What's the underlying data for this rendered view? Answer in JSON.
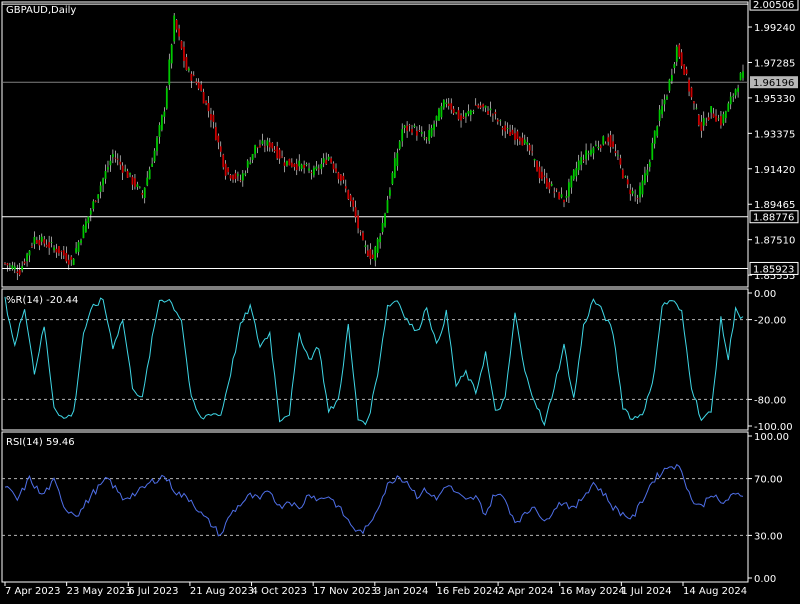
{
  "app": {
    "symbol_title": "GBPAUD,Daily",
    "wr_label": "%R(14) -20.44",
    "rsi_label": "RSI(14) 59.46"
  },
  "colors": {
    "background": "#000000",
    "frame": "#ffffff",
    "bull": "#00c800",
    "bear": "#c80000",
    "wick": "#ffffff",
    "wr_line": "#3fd7e6",
    "rsi_line": "#4f6fe8",
    "level_line": "#b4b4b4",
    "price_line": "#808080",
    "price_tag_bg": "#b7b7b7"
  },
  "chart_data": [
    {
      "type": "candlestick",
      "title": "GBPAUD,Daily",
      "y_ticks": [
        "1.99240",
        "1.97285",
        "1.95330",
        "1.93375",
        "1.91420",
        "1.89465",
        "1.87510",
        "1.85555"
      ],
      "ylim": [
        1.849,
        2.0062
      ],
      "highlighted_prices": [
        "2.00506",
        "1.88776",
        "1.85923"
      ],
      "current_price": "1.96196",
      "x_ticks": [
        "7 Apr 2023",
        "23 May 2023",
        "6 Jul 2023",
        "21 Aug 2023",
        "4 Oct 2023",
        "17 Nov 2023",
        "3 Jan 2024",
        "16 Feb 2024",
        "2 Apr 2024",
        "16 May 2024",
        "1 Jul 2024",
        "14 Aug 2024"
      ],
      "close_keypoints": [
        [
          0,
          1.862
        ],
        [
          6,
          1.858
        ],
        [
          12,
          1.876
        ],
        [
          18,
          1.872
        ],
        [
          22,
          1.869
        ],
        [
          27,
          1.863
        ],
        [
          32,
          1.881
        ],
        [
          38,
          1.902
        ],
        [
          44,
          1.922
        ],
        [
          50,
          1.911
        ],
        [
          56,
          1.9
        ],
        [
          61,
          1.924
        ],
        [
          65,
          1.948
        ],
        [
          69,
          1.996
        ],
        [
          74,
          1.969
        ],
        [
          79,
          1.96
        ],
        [
          84,
          1.943
        ],
        [
          90,
          1.913
        ],
        [
          96,
          1.908
        ],
        [
          102,
          1.926
        ],
        [
          108,
          1.928
        ],
        [
          114,
          1.918
        ],
        [
          120,
          1.916
        ],
        [
          126,
          1.912
        ],
        [
          132,
          1.921
        ],
        [
          138,
          1.906
        ],
        [
          142,
          1.892
        ],
        [
          146,
          1.872
        ],
        [
          150,
          1.865
        ],
        [
          154,
          1.884
        ],
        [
          158,
          1.911
        ],
        [
          162,
          1.936
        ],
        [
          166,
          1.937
        ],
        [
          172,
          1.93
        ],
        [
          176,
          1.942
        ],
        [
          180,
          1.952
        ],
        [
          186,
          1.941
        ],
        [
          192,
          1.949
        ],
        [
          198,
          1.946
        ],
        [
          204,
          1.935
        ],
        [
          210,
          1.932
        ],
        [
          214,
          1.924
        ],
        [
          218,
          1.911
        ],
        [
          224,
          1.902
        ],
        [
          228,
          1.897
        ],
        [
          234,
          1.918
        ],
        [
          240,
          1.926
        ],
        [
          246,
          1.931
        ],
        [
          250,
          1.919
        ],
        [
          254,
          1.904
        ],
        [
          258,
          1.898
        ],
        [
          262,
          1.914
        ],
        [
          266,
          1.94
        ],
        [
          270,
          1.956
        ],
        [
          274,
          1.981
        ],
        [
          277,
          1.969
        ],
        [
          280,
          1.953
        ],
        [
          284,
          1.937
        ],
        [
          288,
          1.946
        ],
        [
          292,
          1.94
        ],
        [
          296,
          1.952
        ],
        [
          300,
          1.965
        ]
      ]
    },
    {
      "type": "line",
      "title": "%R(14) -20.44",
      "y_ticks": [
        "0.00",
        "-20.00",
        "-80.00",
        "-100.00"
      ],
      "ylim": [
        -100,
        0
      ],
      "levels": [
        -20,
        -80
      ],
      "keypoints": [
        [
          0,
          -5
        ],
        [
          4,
          -40
        ],
        [
          8,
          -10
        ],
        [
          12,
          -60
        ],
        [
          16,
          -25
        ],
        [
          20,
          -85
        ],
        [
          24,
          -95
        ],
        [
          28,
          -90
        ],
        [
          32,
          -30
        ],
        [
          36,
          -10
        ],
        [
          40,
          -5
        ],
        [
          44,
          -40
        ],
        [
          48,
          -20
        ],
        [
          52,
          -70
        ],
        [
          56,
          -80
        ],
        [
          60,
          -35
        ],
        [
          63,
          -5
        ],
        [
          67,
          -5
        ],
        [
          72,
          -20
        ],
        [
          76,
          -80
        ],
        [
          80,
          -95
        ],
        [
          84,
          -90
        ],
        [
          88,
          -92
        ],
        [
          92,
          -60
        ],
        [
          96,
          -25
        ],
        [
          100,
          -10
        ],
        [
          104,
          -40
        ],
        [
          108,
          -30
        ],
        [
          112,
          -95
        ],
        [
          116,
          -90
        ],
        [
          120,
          -30
        ],
        [
          124,
          -50
        ],
        [
          128,
          -40
        ],
        [
          132,
          -90
        ],
        [
          136,
          -80
        ],
        [
          140,
          -25
        ],
        [
          144,
          -95
        ],
        [
          148,
          -97
        ],
        [
          152,
          -60
        ],
        [
          156,
          -10
        ],
        [
          160,
          -5
        ],
        [
          164,
          -20
        ],
        [
          168,
          -30
        ],
        [
          172,
          -10
        ],
        [
          176,
          -40
        ],
        [
          180,
          -15
        ],
        [
          184,
          -70
        ],
        [
          188,
          -60
        ],
        [
          192,
          -75
        ],
        [
          196,
          -45
        ],
        [
          200,
          -90
        ],
        [
          204,
          -80
        ],
        [
          208,
          -15
        ],
        [
          212,
          -60
        ],
        [
          216,
          -80
        ],
        [
          220,
          -100
        ],
        [
          224,
          -70
        ],
        [
          228,
          -40
        ],
        [
          232,
          -80
        ],
        [
          236,
          -25
        ],
        [
          240,
          -5
        ],
        [
          244,
          -15
        ],
        [
          248,
          -30
        ],
        [
          252,
          -85
        ],
        [
          256,
          -95
        ],
        [
          260,
          -90
        ],
        [
          264,
          -70
        ],
        [
          268,
          -10
        ],
        [
          272,
          -5
        ],
        [
          276,
          -15
        ],
        [
          280,
          -70
        ],
        [
          284,
          -95
        ],
        [
          288,
          -90
        ],
        [
          292,
          -20
        ],
        [
          295,
          -50
        ],
        [
          298,
          -10
        ],
        [
          300,
          -20
        ]
      ]
    },
    {
      "type": "line",
      "title": "RSI(14) 59.46",
      "y_ticks": [
        "100.00",
        "70.00",
        "30.00",
        "0.00"
      ],
      "ylim": [
        0,
        100
      ],
      "levels": [
        70,
        30
      ],
      "keypoints": [
        [
          0,
          65
        ],
        [
          5,
          55
        ],
        [
          10,
          70
        ],
        [
          15,
          58
        ],
        [
          20,
          68
        ],
        [
          25,
          48
        ],
        [
          30,
          45
        ],
        [
          36,
          60
        ],
        [
          42,
          70
        ],
        [
          48,
          56
        ],
        [
          54,
          60
        ],
        [
          60,
          68
        ],
        [
          65,
          72
        ],
        [
          70,
          60
        ],
        [
          76,
          55
        ],
        [
          80,
          45
        ],
        [
          84,
          38
        ],
        [
          88,
          30
        ],
        [
          92,
          45
        ],
        [
          96,
          52
        ],
        [
          100,
          58
        ],
        [
          104,
          55
        ],
        [
          108,
          62
        ],
        [
          112,
          50
        ],
        [
          116,
          55
        ],
        [
          120,
          48
        ],
        [
          124,
          60
        ],
        [
          128,
          55
        ],
        [
          132,
          58
        ],
        [
          136,
          50
        ],
        [
          140,
          40
        ],
        [
          144,
          32
        ],
        [
          148,
          35
        ],
        [
          152,
          50
        ],
        [
          156,
          65
        ],
        [
          160,
          72
        ],
        [
          164,
          68
        ],
        [
          168,
          58
        ],
        [
          172,
          62
        ],
        [
          176,
          55
        ],
        [
          180,
          66
        ],
        [
          184,
          60
        ],
        [
          188,
          54
        ],
        [
          192,
          57
        ],
        [
          196,
          45
        ],
        [
          200,
          60
        ],
        [
          204,
          55
        ],
        [
          208,
          40
        ],
        [
          212,
          44
        ],
        [
          216,
          52
        ],
        [
          220,
          38
        ],
        [
          224,
          50
        ],
        [
          228,
          54
        ],
        [
          232,
          48
        ],
        [
          236,
          58
        ],
        [
          240,
          67
        ],
        [
          244,
          60
        ],
        [
          248,
          50
        ],
        [
          252,
          45
        ],
        [
          256,
          42
        ],
        [
          260,
          55
        ],
        [
          264,
          68
        ],
        [
          268,
          75
        ],
        [
          272,
          80
        ],
        [
          276,
          76
        ],
        [
          280,
          55
        ],
        [
          284,
          50
        ],
        [
          288,
          60
        ],
        [
          292,
          52
        ],
        [
          296,
          57
        ],
        [
          300,
          59
        ]
      ]
    }
  ]
}
